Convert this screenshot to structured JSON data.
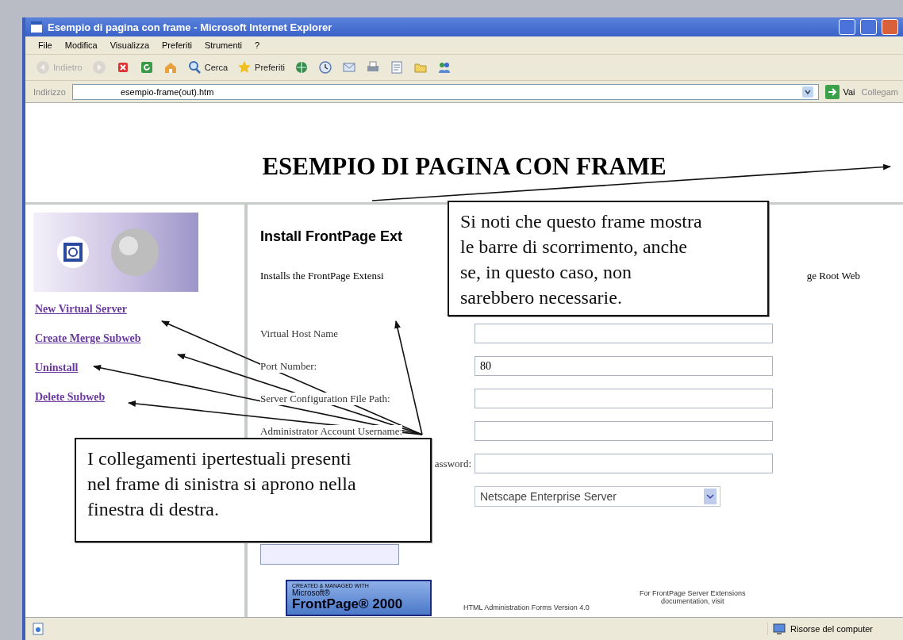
{
  "window": {
    "title": "Esempio di pagina con frame - Microsoft Internet Explorer"
  },
  "menu": [
    "File",
    "Modifica",
    "Visualizza",
    "Preferiti",
    "Strumenti",
    "?"
  ],
  "toolbar": [
    {
      "kind": "back",
      "label": "Indietro",
      "disabled": true
    },
    {
      "kind": "forward",
      "disabled": true
    },
    {
      "kind": "stop",
      "disabled": false
    },
    {
      "kind": "refresh",
      "disabled": false
    },
    {
      "kind": "home",
      "disabled": false
    },
    {
      "kind": "search",
      "label": "Cerca",
      "disabled": false
    },
    {
      "kind": "favorites",
      "label": "Preferiti",
      "disabled": false
    },
    {
      "kind": "media",
      "disabled": false
    },
    {
      "kind": "history",
      "disabled": false
    },
    {
      "kind": "mail",
      "disabled": false
    },
    {
      "kind": "print",
      "disabled": false
    },
    {
      "kind": "edit",
      "disabled": false
    },
    {
      "kind": "folder",
      "disabled": false
    },
    {
      "kind": "messenger",
      "disabled": false
    }
  ],
  "address_bar": {
    "label": "Indirizzo",
    "value": "esempio-frame(out).htm",
    "go": "Vai",
    "links": "Collegam"
  },
  "top_frame": {
    "heading": "ESEMPIO DI PAGINA CON FRAME"
  },
  "left_frame": {
    "links": [
      "New Virtual Server",
      "Create Merge Subweb",
      "Uninstall",
      "Delete Subweb"
    ]
  },
  "right_frame": {
    "heading": "Install FrontPage Ext",
    "intro": "Installs the FrontPage Extensi",
    "intro_end": "ge Root Web",
    "fields": [
      {
        "kind": "text",
        "label": "Virtual Host Name"
      },
      {
        "kind": "text",
        "label": "Port Number:",
        "value": "80"
      },
      {
        "kind": "text",
        "label": "Server Configuration File Path:"
      },
      {
        "kind": "text",
        "label": "Administrator Account Username:"
      },
      {
        "kind": "text",
        "label": "assword:"
      },
      {
        "kind": "select",
        "value": "Netscape Enterprise Server"
      }
    ],
    "badge": [
      "CREATED & MANAGED WITH",
      "Microsoft®",
      "FrontPage® 2000"
    ],
    "version": "HTML Administration Forms Version 4.0",
    "docs": "For FrontPage Server Extensions documentation, visit"
  },
  "status_bar": {
    "zone": "Risorse del computer"
  },
  "callouts": [
    "Si noti che questo frame mostra le barre di scorrimento, anche se, in questo caso, non sarebbero necessarie.",
    "I collegamenti ipertestuali presenti nel frame di sinistra si aprono nella finestra di destra."
  ]
}
